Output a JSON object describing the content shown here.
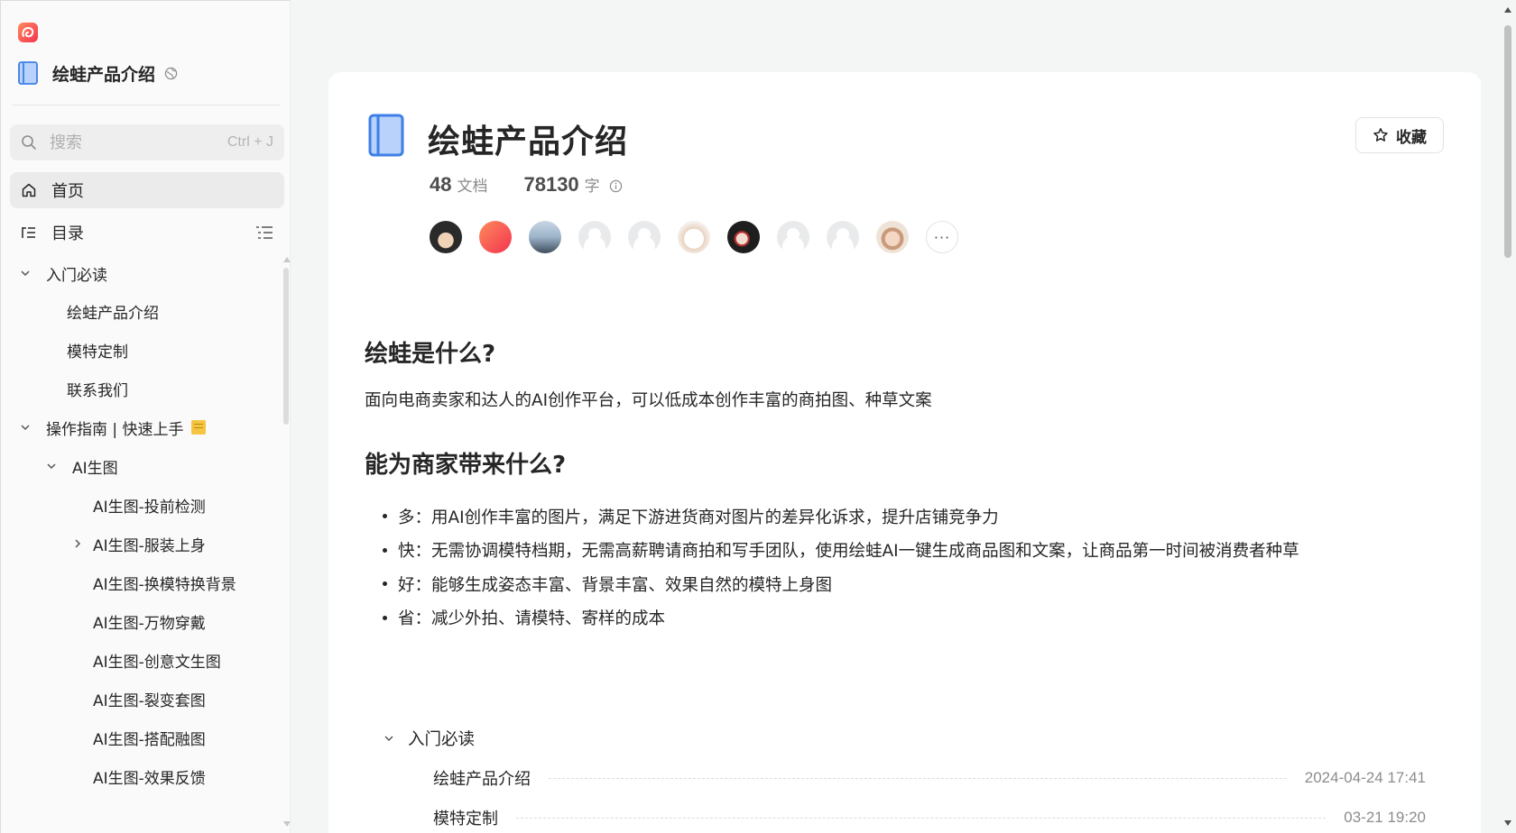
{
  "sidebar": {
    "book_title": "绘蛙产品介绍",
    "search": {
      "placeholder": "搜索",
      "shortcut": "Ctrl + J"
    },
    "home_label": "首页",
    "toc_label": "目录",
    "tree": [
      {
        "label": "入门必读",
        "level": 0,
        "expanded": true
      },
      {
        "label": "绘蛙产品介绍",
        "level": 1
      },
      {
        "label": "模特定制",
        "level": 1
      },
      {
        "label": "联系我们",
        "level": 1
      },
      {
        "label": "操作指南 | 快速上手",
        "level": 0,
        "expanded": true,
        "emoji": "notebook"
      },
      {
        "label": "AI生图",
        "level": 1,
        "expanded": true
      },
      {
        "label": "AI生图-投前检测",
        "level": 2
      },
      {
        "label": "AI生图-服装上身",
        "level": 2,
        "expanded": false
      },
      {
        "label": "AI生图-换模特换背景",
        "level": 2
      },
      {
        "label": "AI生图-万物穿戴",
        "level": 2
      },
      {
        "label": "AI生图-创意文生图",
        "level": 2
      },
      {
        "label": "AI生图-裂变套图",
        "level": 2
      },
      {
        "label": "AI生图-搭配融图",
        "level": 2
      },
      {
        "label": "AI生图-效果反馈",
        "level": 2
      }
    ]
  },
  "page": {
    "title": "绘蛙产品介绍",
    "favorite_label": "收藏",
    "doc_count": "48",
    "doc_unit": "文档",
    "word_count": "78130",
    "word_unit": "字",
    "more_label": "···",
    "avatars": [
      "dark-anime",
      "brand-red",
      "landscape",
      "default",
      "default",
      "cat",
      "dark-anime-2",
      "default",
      "default",
      "child"
    ],
    "sections": {
      "what_title": "绘蛙是什么?",
      "what_text": "面向电商卖家和达人的AI创作平台，可以低成本创作丰富的商拍图、种草文案",
      "value_title": "能为商家带来什么?",
      "bullets": [
        "多：用AI创作丰富的图片，满足下游进货商对图片的差异化诉求，提升店铺竞争力",
        "快：无需协调模特档期，无需高薪聘请商拍和写手团队，使用绘蛙AI一键生成商品图和文案，让商品第一时间被消费者种草",
        "好：能够生成姿态丰富、背景丰富、效果自然的模特上身图",
        "省：减少外拍、请模特、寄样的成本"
      ]
    },
    "catalog": {
      "group_label": "入门必读",
      "rows": [
        {
          "title": "绘蛙产品介绍",
          "time": "2024-04-24 17:41"
        },
        {
          "title": "模特定制",
          "time": "03-21 19:20"
        }
      ]
    }
  },
  "colors": {
    "accent": "#3d7fe6",
    "brand": "#f2344f",
    "text": "#262626",
    "muted": "#8c8c8c"
  }
}
